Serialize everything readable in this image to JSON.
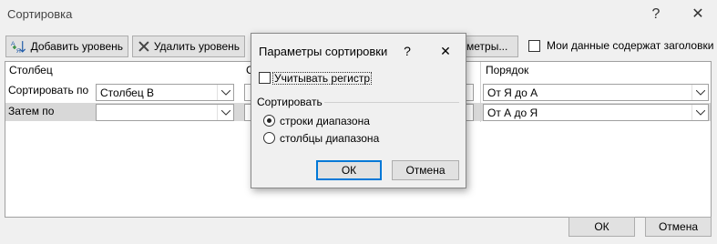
{
  "window": {
    "title": "Сортировка",
    "help": "?",
    "close": "✕"
  },
  "toolbar": {
    "add_level": "Добавить уровень",
    "delete_level": "Удалить уровень",
    "options_partial": "метры...",
    "headers_checkbox_label": "Мои данные содержат заголовки",
    "headers_checked": false
  },
  "grid": {
    "headers": {
      "column": "Столбец",
      "sort_on_partial": "С",
      "order": "Порядок"
    },
    "rows": [
      {
        "label": "Сортировать по",
        "column_value": "Столбец B",
        "order_value": "От Я до А"
      },
      {
        "label": "Затем по",
        "column_value": "",
        "order_value": "От А до Я"
      }
    ]
  },
  "footer": {
    "ok": "ОК",
    "cancel": "Отмена"
  },
  "options_dialog": {
    "title": "Параметры сортировки",
    "help": "?",
    "close": "✕",
    "case_sensitive_label": "Учитывать регистр",
    "case_sensitive_checked": false,
    "orientation_group": "Сортировать",
    "orientation_options": [
      "строки диапазона",
      "столбцы диапазона"
    ],
    "selected_orientation": "строки диапазона",
    "ok": "ОК",
    "cancel": "Отмена"
  },
  "colors": {
    "accent": "#0078d7",
    "selected_row": "#d8d8d8",
    "background": "#f0f0f0"
  }
}
